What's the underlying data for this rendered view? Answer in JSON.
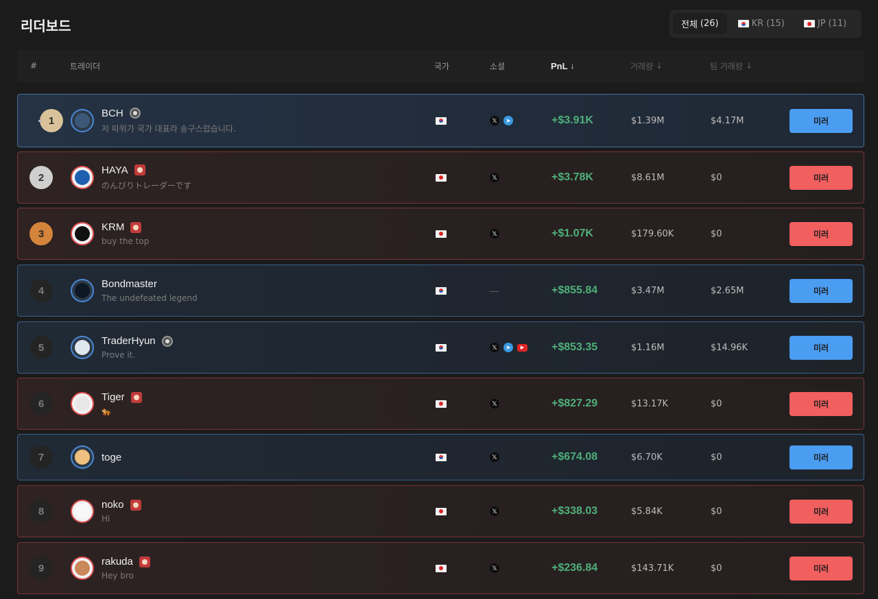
{
  "title": "리더보드",
  "filters": [
    {
      "label": "전체",
      "count": "(26)",
      "flag": "",
      "active": true
    },
    {
      "label": "KR",
      "count": "(15)",
      "flag": "kr",
      "active": false
    },
    {
      "label": "JP",
      "count": "(11)",
      "flag": "jp",
      "active": false
    }
  ],
  "columns": {
    "rank": "#",
    "trader": "트레이더",
    "country": "국가",
    "social": "소셜",
    "pnl": "PnL",
    "volume": "거래량",
    "team_volume": "팀 거래량"
  },
  "sort_arrow": "↓",
  "mirror_label": "미러",
  "colors": {
    "kr_accent": "#4b9df2",
    "jp_accent": "#f25f5f",
    "pnl_positive": "#4fb07a"
  },
  "traders": [
    {
      "rank": "1",
      "name": "BCH",
      "bio": "저 따위가 국가 대표라 송구스럽습니다.",
      "country": "kr",
      "badge": "kr",
      "socials": [
        "x",
        "telegram"
      ],
      "pnl": "+$3.91K",
      "volume": "$1.39M",
      "team_volume": "$4.17M"
    },
    {
      "rank": "2",
      "name": "HAYA",
      "bio": "のんびりトレーダーです",
      "country": "jp",
      "badge": "jp",
      "socials": [
        "x"
      ],
      "pnl": "+$3.78K",
      "volume": "$8.61M",
      "team_volume": "$0"
    },
    {
      "rank": "3",
      "name": "KRM",
      "bio": "buy the top",
      "country": "jp",
      "badge": "jp",
      "socials": [
        "x"
      ],
      "pnl": "+$1.07K",
      "volume": "$179.60K",
      "team_volume": "$0"
    },
    {
      "rank": "4",
      "name": "Bondmaster",
      "bio": "The undefeated legend",
      "country": "kr",
      "badge": "",
      "socials": [],
      "pnl": "+$855.84",
      "volume": "$3.47M",
      "team_volume": "$2.65M"
    },
    {
      "rank": "5",
      "name": "TraderHyun",
      "bio": "Prove it.",
      "country": "kr",
      "badge": "kr",
      "socials": [
        "x",
        "telegram",
        "youtube"
      ],
      "pnl": "+$853.35",
      "volume": "$1.16M",
      "team_volume": "$14.96K"
    },
    {
      "rank": "6",
      "name": "Tiger",
      "bio": "🐅",
      "country": "jp",
      "badge": "jp",
      "socials": [
        "x"
      ],
      "pnl": "+$827.29",
      "volume": "$13.17K",
      "team_volume": "$0"
    },
    {
      "rank": "7",
      "name": "toge",
      "bio": "",
      "country": "kr",
      "badge": "",
      "socials": [
        "x"
      ],
      "pnl": "+$674.08",
      "volume": "$6.70K",
      "team_volume": "$0"
    },
    {
      "rank": "8",
      "name": "noko",
      "bio": "Hi",
      "country": "jp",
      "badge": "jp",
      "socials": [
        "x"
      ],
      "pnl": "+$338.03",
      "volume": "$5.84K",
      "team_volume": "$0"
    },
    {
      "rank": "9",
      "name": "rakuda",
      "bio": "Hey bro",
      "country": "jp",
      "badge": "jp",
      "socials": [
        "x"
      ],
      "pnl": "+$236.84",
      "volume": "$143.71K",
      "team_volume": "$0"
    }
  ]
}
